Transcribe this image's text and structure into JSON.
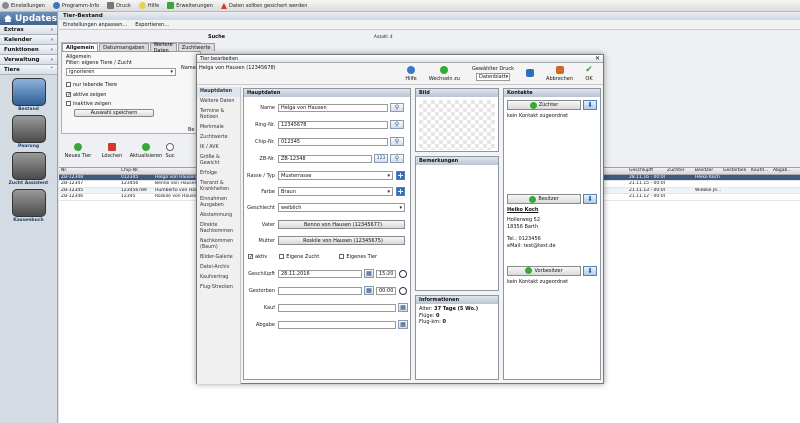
{
  "topbar": {
    "items": [
      "Einstellungen",
      "Programm-Info",
      "Druck",
      "Hilfe",
      "Erweiterungen"
    ],
    "warning": "Daten sollten gesichert werden"
  },
  "sidebar": {
    "title": "Updates",
    "sections": [
      "Extras",
      "Kalender",
      "Funktionen",
      "Verwaltung",
      "Tiere"
    ],
    "tiles": [
      "Bestand",
      "Paarung",
      "Zucht Assistent",
      "Kassenbuch"
    ]
  },
  "main": {
    "title": "Tier-Bestand",
    "toolbar": [
      "Einstellungen anpassen...",
      "Exportieren..."
    ],
    "tabs": [
      "Allgemein",
      "Datumsangaben",
      "Weitere Daten",
      "Zuchtwerte"
    ],
    "filter": {
      "group": "Allgemein",
      "label": "Filter: eigene Tiere / Zucht",
      "select": "ignorieren",
      "opt_lebend": "nur lebende Tiere",
      "opt_aktiv": "aktive zeigen",
      "opt_inaktiv": "inaktive zeigen",
      "save": "Auswahl speichern",
      "be": "Be"
    },
    "search_label": "Suche",
    "search_label2": "Anzahl: 4",
    "actions": [
      "Neues Tier",
      "Löschen",
      "Aktualisieren",
      "Suc"
    ]
  },
  "grid": {
    "columns": [
      "Nr.",
      "Chip-Nr.",
      "",
      "Geschlüpft",
      "Züchter",
      "Besitzer",
      "Gestorben",
      "Kaufd...",
      "Abgab..."
    ],
    "rows": [
      {
        "nr": "ZB-12348",
        "chip": "012345",
        "name": "Helga von Hausen",
        "geschl": "28.11.16 - 00:00",
        "zuechter": "",
        "besitzer": "Heiko Koch",
        "gest": ""
      },
      {
        "nr": "ZB-12347",
        "chip": "123456",
        "name": "Benno von Hausen",
        "geschl": "21.11.15 - 00:00",
        "zuechter": "",
        "besitzer": "",
        "gest": ""
      },
      {
        "nr": "ZB-12345",
        "chip": "123456789",
        "name": "Humberto von Hausen",
        "geschl": "21.11.13 - 00:00",
        "zuechter": "",
        "besitzer": "Wiebke Je...",
        "gest": ""
      },
      {
        "nr": "ZB-12346",
        "chip": "12345",
        "name": "Roskile von Hausen",
        "geschl": "21.11.12 - 00:00",
        "zuechter": "",
        "besitzer": "",
        "gest": ""
      }
    ]
  },
  "dialog": {
    "title": "Tier bearbeiten",
    "subtitle": "Name: Helga von Hausen (12345678)",
    "toolbar": {
      "help": "Hilfe",
      "switch": "Wechseln zu",
      "print_label": "Gewählter Druck",
      "print_value": "Datenblatt",
      "cancel": "Abbrechen",
      "ok": "OK"
    },
    "nav": [
      "Hauptdaten",
      "Weitere Daten",
      "Termine & Notizen",
      "Merkmale",
      "Zuchtwerte",
      "IK / AVK",
      "Größe & Gewicht",
      "Erfolge",
      "Tierarzt & Krankheiten",
      "Einnahmen Ausgaben",
      "Abstammung",
      "Direkte Nachkommen",
      "Nachkommen (Baum)",
      "Bilder-Galerie",
      "Datei-Archiv",
      "Kaufvertrag",
      "Flug-Strecken"
    ],
    "hauptdaten": {
      "header": "Hauptdaten",
      "name_label": "Name",
      "name": "Helga von Hausen",
      "ring_label": "Ring-Nr.",
      "ring": "12345678",
      "chip_label": "Chip-Nr.",
      "chip": "012345",
      "zb_label": "ZB-Nr.",
      "zb": "ZB-12348",
      "zb_btn": "123",
      "rasse_label": "Rasse / Typ",
      "rasse": "Musterrasse",
      "farbe_label": "Farbe",
      "farbe": "Braun",
      "geschlecht_label": "Geschlecht",
      "geschlecht": "weiblich",
      "vater_label": "Vater",
      "vater": "Benno von Hausen (12345677)",
      "mutter_label": "Mutter",
      "mutter": "Roskile von Hausen (12345675)",
      "aktiv": "aktiv",
      "eigene_zucht": "Eigene Zucht",
      "eigenes_tier": "Eigenes Tier",
      "geschluepft_label": "Geschlüpft",
      "geschluepft": "28.11.2016",
      "geschluepft_time": "15:20",
      "gestorben_label": "Gestorben",
      "gestorben_time": "00:00",
      "kauf_label": "Kauf",
      "abgabe_label": "Abgabe"
    },
    "bild": "Bild",
    "bemerkungen": "Bemerkungen",
    "informationen": {
      "header": "Informationen",
      "alter_label": "Alter:",
      "alter": "37 Tage (5 Wo.)",
      "fluege_label": "Flüge:",
      "fluege": "0",
      "flugkm_label": "Flug-km:",
      "flugkm": "0"
    },
    "kontakte": {
      "header": "Kontakte",
      "zuechter_btn": "Züchter",
      "none1": "kein Kontakt zugeordnet",
      "besitzer_btn": "Besitzer",
      "besitzer_name": "Heiko Koch",
      "besitzer_street": "Hollerweg 52",
      "besitzer_city": "18356 Barth",
      "besitzer_tel": "Tel.: 0123456",
      "besitzer_mail": "eMail: test@test.de",
      "vorbesitzer_btn": "Vorbesitzer",
      "none2": "kein Kontakt zugeordnet"
    }
  },
  "colors": {
    "accent": "#3f628f",
    "selected_row": "#3e5a7e",
    "green": "#38a838",
    "red": "#d03a2a"
  }
}
